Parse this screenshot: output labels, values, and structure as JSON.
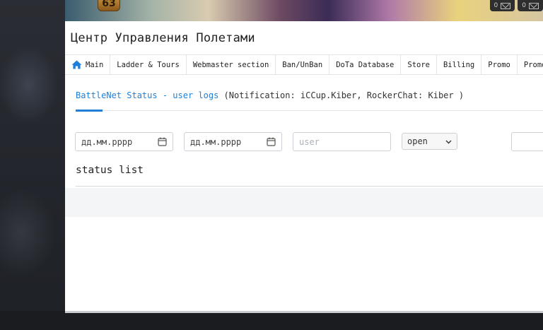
{
  "banner": {
    "rank_level": "63",
    "widgets": [
      {
        "count": "0",
        "icon": "mail-icon"
      },
      {
        "count": "0",
        "icon": "mail-icon"
      }
    ]
  },
  "site": {
    "title": "Центр Управления Полетами"
  },
  "nav": {
    "items": [
      {
        "label": "Main",
        "icon": "home-icon"
      },
      {
        "label": "Ladder & Tours"
      },
      {
        "label": "Webmaster section"
      },
      {
        "label": "Ban/UnBan"
      },
      {
        "label": "DoTa Database"
      },
      {
        "label": "Store"
      },
      {
        "label": "Billing"
      },
      {
        "label": "Promo"
      },
      {
        "label": "Promo"
      }
    ]
  },
  "status": {
    "link": "BattleNet Status - user logs",
    "details": " (Notification: iCCup.Kiber, RockerChat: Kiber )"
  },
  "filters": {
    "date_from_placeholder": "дд.мм.рррр",
    "date_to_placeholder": "дд.мм.рррр",
    "user_placeholder": "user",
    "state_selected": "open"
  },
  "section": {
    "title": "status list"
  },
  "colors": {
    "accent": "#1f7fd8",
    "text": "#222222",
    "border": "#ced2d8"
  }
}
